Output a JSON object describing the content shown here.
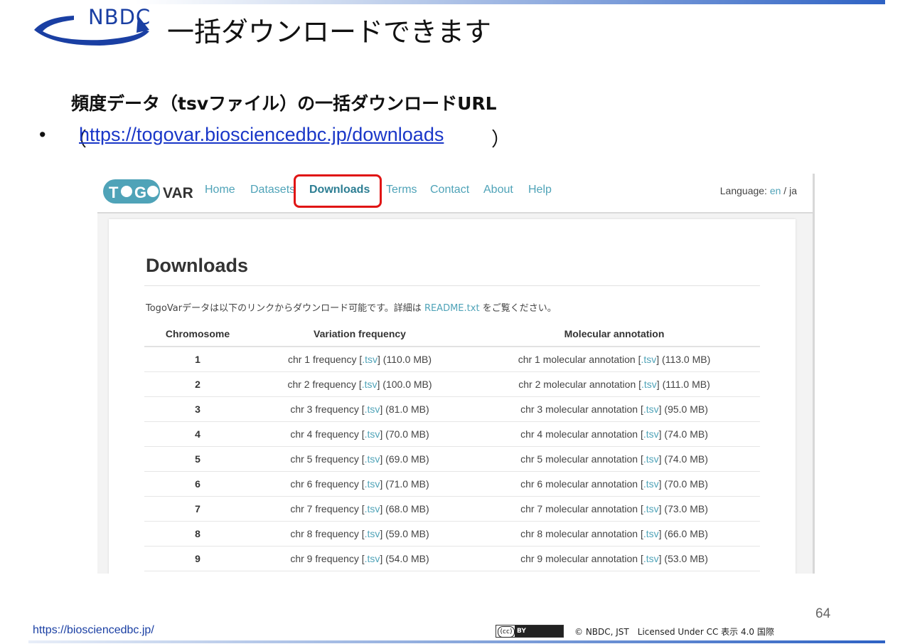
{
  "slide": {
    "logo_text": "NBDC",
    "title": "一括ダウンロードできます",
    "subtitle": "頻度データ（tsvファイル）の一括ダウンロードURL",
    "bullet": "•",
    "paren_open": "（",
    "url": "https://togovar.biosciencedbc.jp/downloads",
    "paren_close": "）",
    "page_number": "64",
    "footer_url": "https://biosciencedbc.jp/",
    "cc_left": "(cc)",
    "cc_right": "BY",
    "license": "© NBDC, JST　Licensed Under CC 表示 4.0 国際"
  },
  "togovar": {
    "logo": "TOGOVAR",
    "nav": [
      "Home",
      "Datasets",
      "Downloads",
      "Terms",
      "Contact",
      "About",
      "Help"
    ],
    "active_nav": "Downloads",
    "language_label": "Language: ",
    "lang_en": "en",
    "lang_sep": " / ",
    "lang_ja": "ja",
    "page_title": "Downloads",
    "desc_prefix": "TogoVarデータは以下のリンクからダウンロード可能です。詳細は",
    "desc_link": "README.txt",
    "desc_suffix": "をご覧ください。",
    "columns": [
      "Chromosome",
      "Variation frequency",
      "Molecular annotation"
    ],
    "rows": [
      {
        "chr": "1",
        "freq_pre": "chr 1 frequency [",
        "freq_size": "] (110.0 MB)",
        "anno_pre": "chr 1 molecular annotation [",
        "anno_size": "] (113.0 MB)"
      },
      {
        "chr": "2",
        "freq_pre": "chr 2 frequency [",
        "freq_size": "] (100.0 MB)",
        "anno_pre": "chr 2 molecular annotation [",
        "anno_size": "] (111.0 MB)"
      },
      {
        "chr": "3",
        "freq_pre": "chr 3 frequency [",
        "freq_size": "] (81.0 MB)",
        "anno_pre": "chr 3 molecular annotation [",
        "anno_size": "] (95.0 MB)"
      },
      {
        "chr": "4",
        "freq_pre": "chr 4 frequency [",
        "freq_size": "] (70.0 MB)",
        "anno_pre": "chr 4 molecular annotation [",
        "anno_size": "] (74.0 MB)"
      },
      {
        "chr": "5",
        "freq_pre": "chr 5 frequency [",
        "freq_size": "] (69.0 MB)",
        "anno_pre": "chr 5 molecular annotation [",
        "anno_size": "] (74.0 MB)"
      },
      {
        "chr": "6",
        "freq_pre": "chr 6 frequency [",
        "freq_size": "] (71.0 MB)",
        "anno_pre": "chr 6 molecular annotation [",
        "anno_size": "] (70.0 MB)"
      },
      {
        "chr": "7",
        "freq_pre": "chr 7 frequency [",
        "freq_size": "] (68.0 MB)",
        "anno_pre": "chr 7 molecular annotation [",
        "anno_size": "] (73.0 MB)"
      },
      {
        "chr": "8",
        "freq_pre": "chr 8 frequency [",
        "freq_size": "] (59.0 MB)",
        "anno_pre": "chr 8 molecular annotation [",
        "anno_size": "] (66.0 MB)"
      },
      {
        "chr": "9",
        "freq_pre": "chr 9 frequency [",
        "freq_size": "] (54.0 MB)",
        "anno_pre": "chr 9 molecular annotation [",
        "anno_size": "] (53.0 MB)"
      }
    ],
    "link_text": ".tsv"
  },
  "colors": {
    "link_teal": "#4fa3b8",
    "highlight_red": "#e01515",
    "nbdc_blue": "#1a3fa3"
  }
}
